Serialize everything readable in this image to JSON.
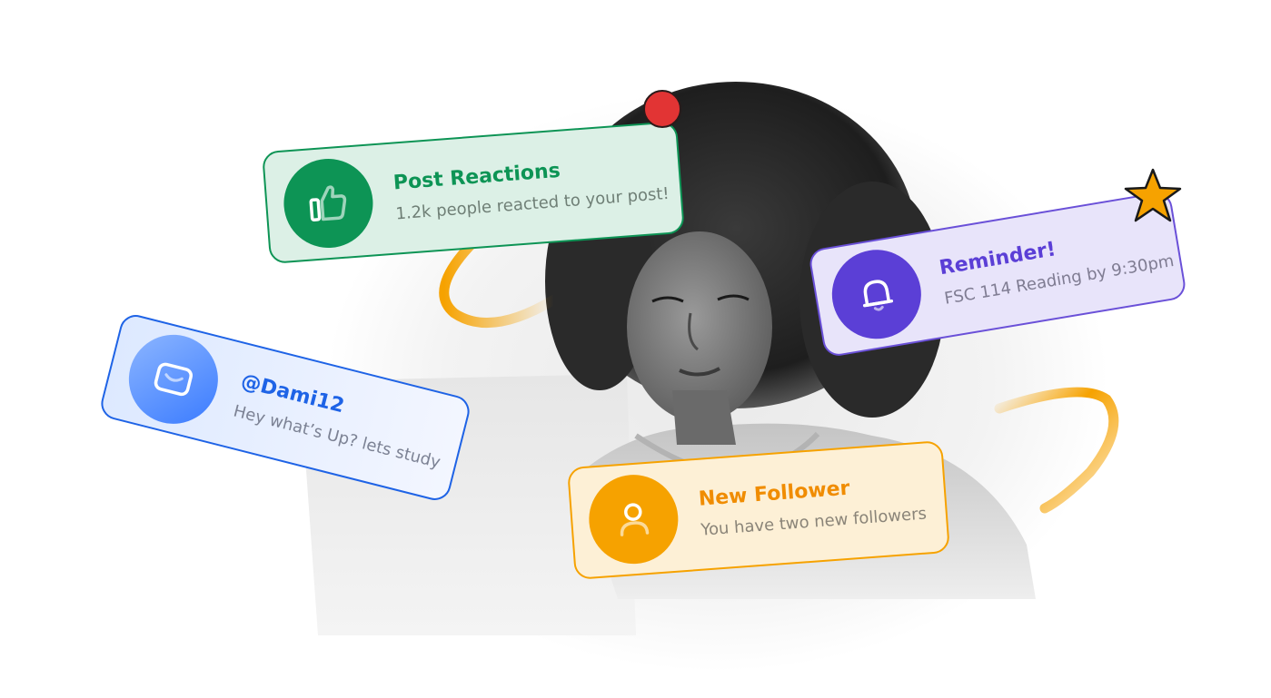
{
  "notifications": {
    "reactions": {
      "title": "Post Reactions",
      "body": "1.2k people reacted to your post!",
      "icon": "thumbs-up-icon",
      "color": "#0d9455"
    },
    "reminder": {
      "title": "Reminder!",
      "body": "FSC 114 Reading by 9:30pm",
      "icon": "bell-icon",
      "color": "#5b3fd6"
    },
    "message": {
      "title": "@Dami12",
      "body": "Hey what’s Up? lets study",
      "icon": "mail-icon",
      "color": "#1e63e6"
    },
    "follower": {
      "title": "New Follower",
      "body": "You have two new followers",
      "icon": "user-icon",
      "color": "#f6a200"
    }
  },
  "decorations": {
    "dot_color": "#e23434",
    "star_color": "#f6a200",
    "swirl_color": "#f6a200"
  }
}
